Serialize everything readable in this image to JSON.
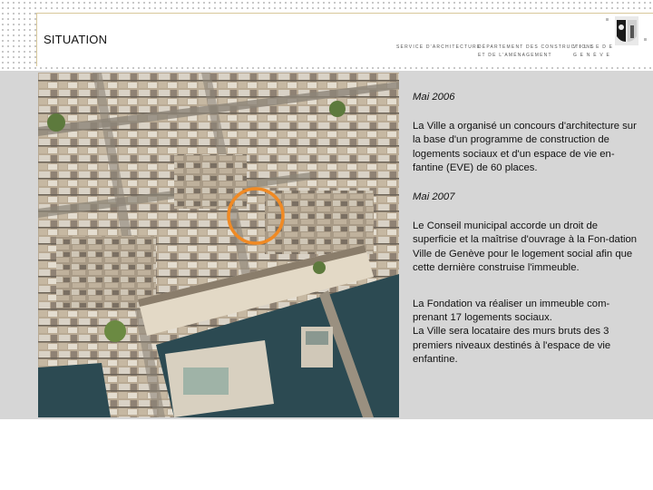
{
  "header": {
    "title": "SITUATION",
    "logo_left": "SERVICE D'ARCHITECTURE",
    "logo_mid_line1": "DÉPARTEMENT DES CONSTRUCTIONS",
    "logo_mid_line2": "ET DE L'AMÉNAGEMENT",
    "logo_right_line1": "V I L L E   D E",
    "logo_right_line2": "G E N È V E"
  },
  "photo": {
    "description_icon": "aerial-photo"
  },
  "content": {
    "date1": "Mai 2006",
    "para1": "La Ville a organisé un concours d'architecture sur la base d'un programme de construction de logements sociaux et d'un espace de vie en-fantine (EVE) de 60 places.",
    "date2": "Mai 2007",
    "para2": "Le Conseil municipal accorde un droit de superficie et la maîtrise d'ouvrage à la Fon-dation Ville de Genève pour le logement social afin que cette dernière construise l'immeuble.",
    "para3": "La Fondation va réaliser un immeuble com-prenant 17 logements sociaux.",
    "para4": "La Ville sera locataire des murs bruts des 3 premiers niveaux destinés à l'espace de vie enfantine."
  },
  "colors": {
    "accent_ring": "#f08a24",
    "panel": "#d6d6d6",
    "water": "#2c4a52"
  }
}
